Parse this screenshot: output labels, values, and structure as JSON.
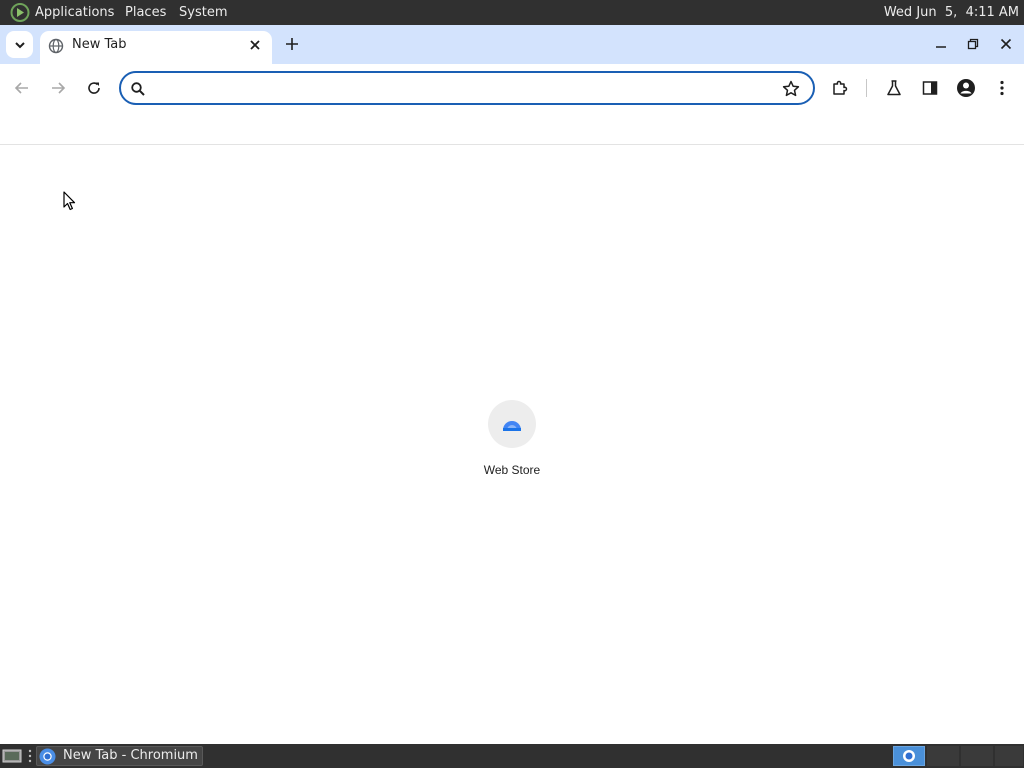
{
  "top_panel": {
    "menus": [
      "Applications",
      "Places",
      "System"
    ],
    "clock": "Wed Jun  5,  4:11 AM"
  },
  "browser": {
    "active_tab": {
      "title": "New Tab",
      "favicon": "globe-icon"
    },
    "omnibox": {
      "value": "",
      "placeholder": ""
    },
    "icons": {
      "tab_search": "chevron-down-icon",
      "close_tab": "close-icon",
      "new_tab": "plus-icon",
      "back": "back-arrow-icon",
      "forward": "forward-arrow-icon",
      "reload": "reload-icon",
      "bookmark": "star-icon",
      "extensions": "puzzle-icon",
      "labs": "flask-icon",
      "side_panel": "side-panel-icon",
      "profile": "profile-icon",
      "menu": "kebab-menu-icon"
    },
    "accent_color": "#1a5fb4",
    "tab_strip_color": "#d3e3fd"
  },
  "new_tab_page": {
    "shortcuts": [
      {
        "label": "Web Store",
        "icon": "web-store-icon"
      }
    ]
  },
  "bottom_panel": {
    "taskbar_items": [
      {
        "label": "New Tab - Chromium",
        "icon": "chromium-icon"
      }
    ],
    "workspaces_count": 4,
    "active_workspace": 1
  }
}
